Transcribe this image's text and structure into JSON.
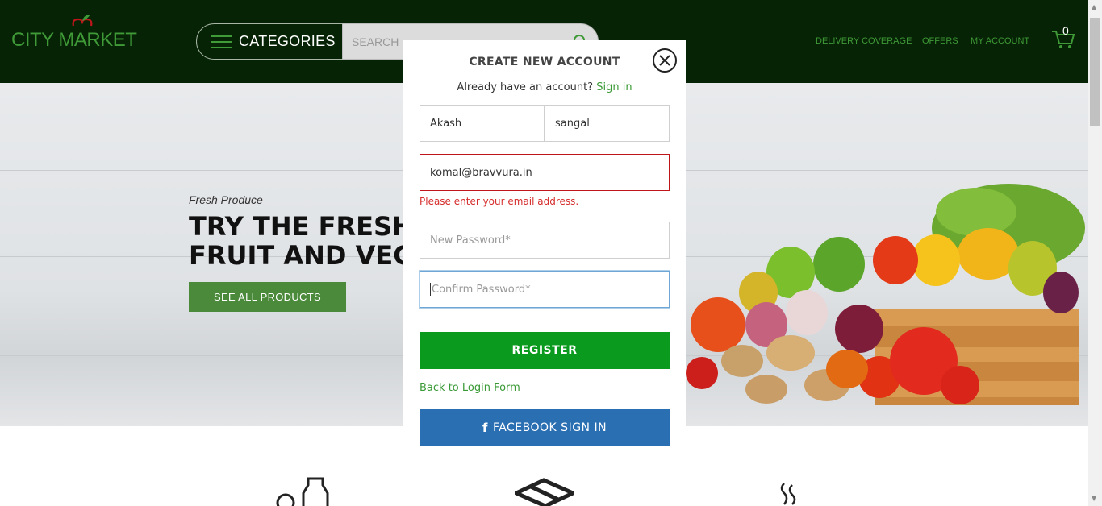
{
  "header": {
    "logo_text": "CITY MARKET",
    "categories_label": "CATEGORIES",
    "search_placeholder": "SEARCH",
    "nav": [
      "DELIVERY COVERAGE",
      "OFFERS",
      "MY ACCOUNT"
    ],
    "cart_count": "0"
  },
  "hero": {
    "subtitle": "Fresh Produce",
    "title_line1": "TRY THE FRESHEST",
    "title_line2": "FRUIT AND VEGETABLES",
    "button": "SEE ALL PRODUCTS"
  },
  "modal": {
    "title": "CREATE NEW ACCOUNT",
    "have_account": "Already have an account?",
    "sign_in": "Sign in",
    "first_name": "Akash",
    "last_name": "sangal",
    "email": "komal@bravvura.in",
    "email_error": "Please enter your email address.",
    "new_password_placeholder": "New Password*",
    "confirm_password_placeholder": "Confirm Password*",
    "register": "REGISTER",
    "back_to_login": "Back to Login Form",
    "facebook": "FACEBOOK SIGN IN"
  },
  "colors": {
    "header_bg": "#062405",
    "brand_green": "#3f9a37",
    "register_green": "#0a9a1e",
    "facebook_blue": "#2b6fb3",
    "error_red": "#d62d2d"
  },
  "icons": [
    "hamburger-icon",
    "search-icon",
    "cart-icon",
    "close-icon",
    "facebook-icon",
    "apple-logo-icon"
  ]
}
